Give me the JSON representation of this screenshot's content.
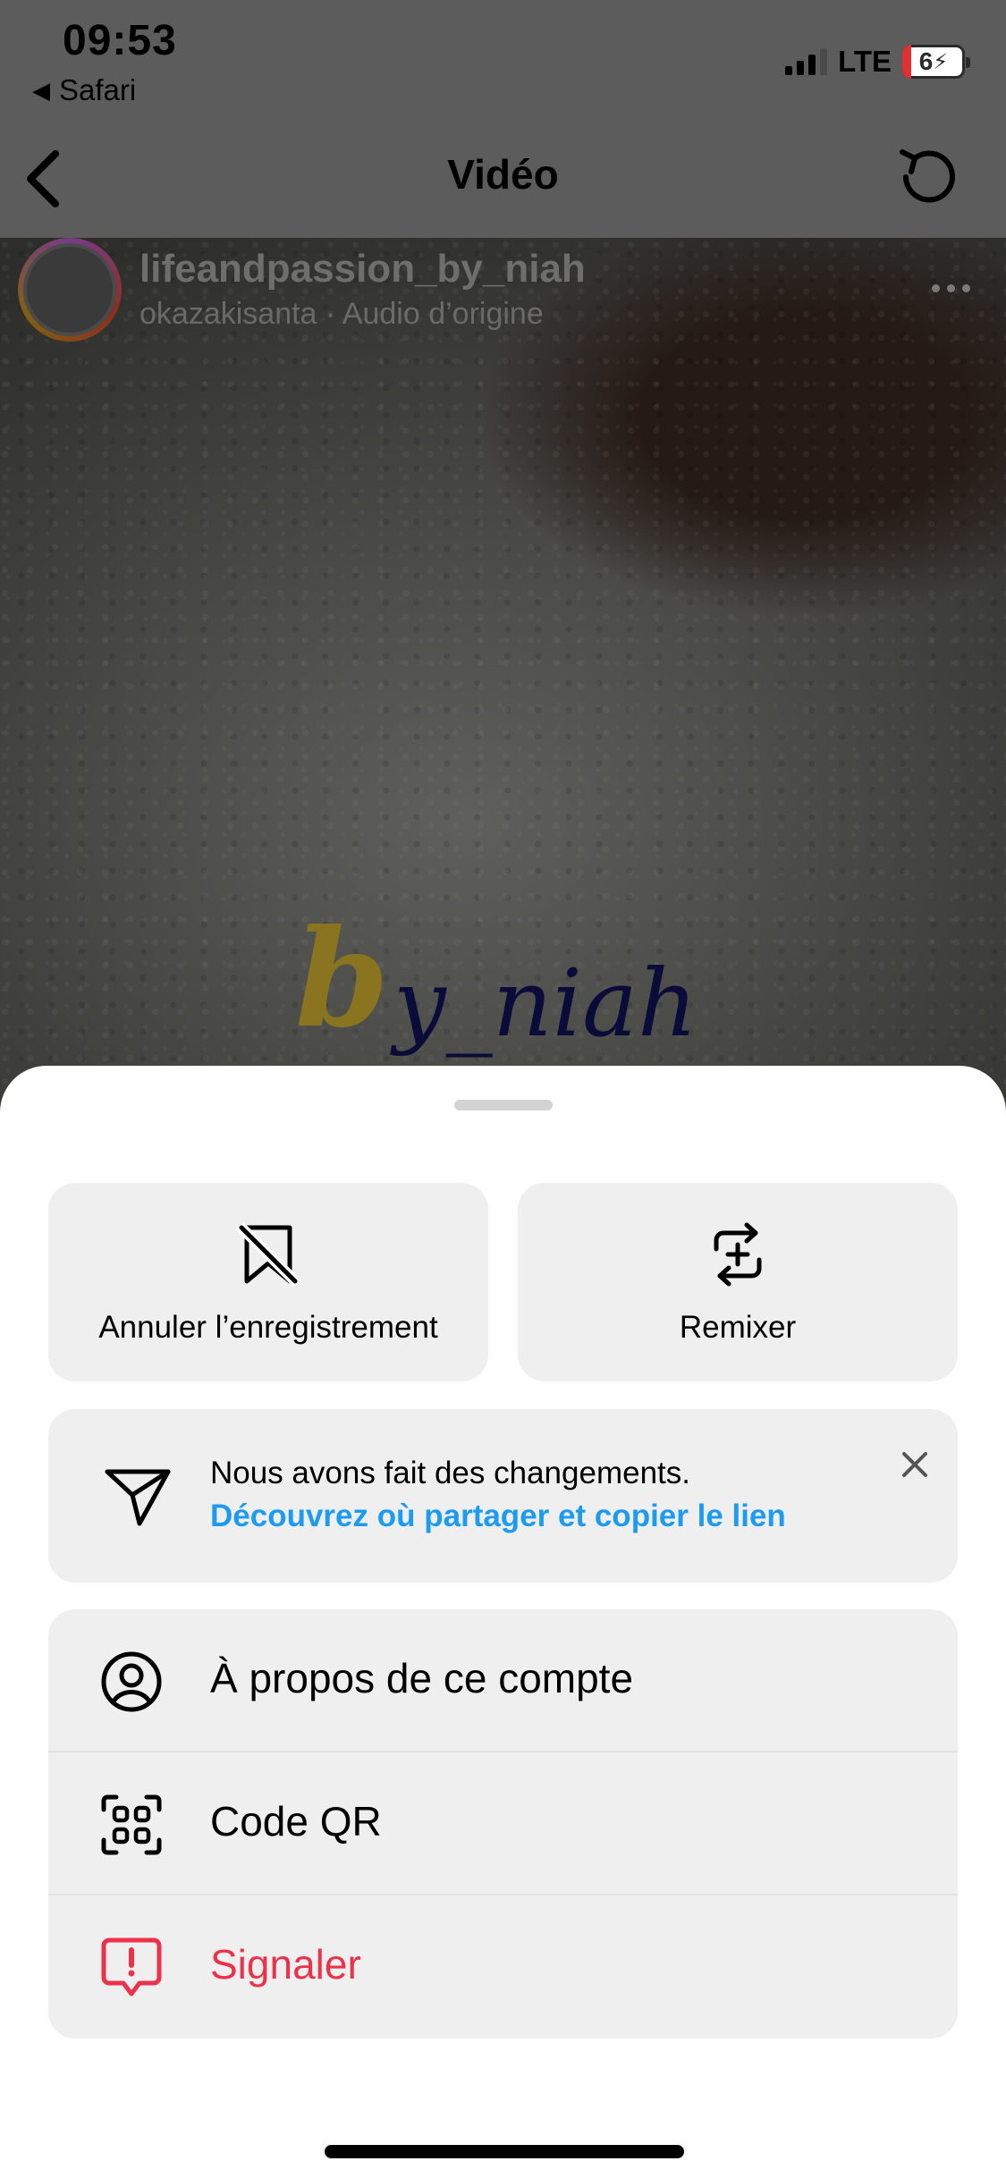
{
  "status_bar": {
    "time": "09:53",
    "back_app": "Safari",
    "network": "LTE",
    "battery": "6"
  },
  "nav": {
    "title": "Vidéo"
  },
  "post": {
    "username": "lifeandpassion_by_niah",
    "subtitle": "okazakisanta · Audio d’origine",
    "watermark_initial": "b",
    "watermark_text": "y_niah"
  },
  "sheet": {
    "actions": [
      {
        "label": "Annuler l’enregistrement",
        "icon": "unsave-bookmark-icon"
      },
      {
        "label": "Remixer",
        "icon": "remix-icon"
      }
    ],
    "notice": {
      "title": "Nous avons fait des changements.",
      "link": "Découvrez où partager et copier le lien",
      "icon": "send-icon"
    },
    "menu": [
      {
        "label": "À propos de ce compte",
        "icon": "account-circle-icon"
      },
      {
        "label": "Code QR",
        "icon": "qr-code-icon"
      },
      {
        "label": "Signaler",
        "icon": "report-icon",
        "color": "#ea334a"
      }
    ]
  },
  "colors": {
    "accent_link": "#1d9bf0",
    "danger": "#ea334a",
    "sheet_card": "#efefef"
  }
}
